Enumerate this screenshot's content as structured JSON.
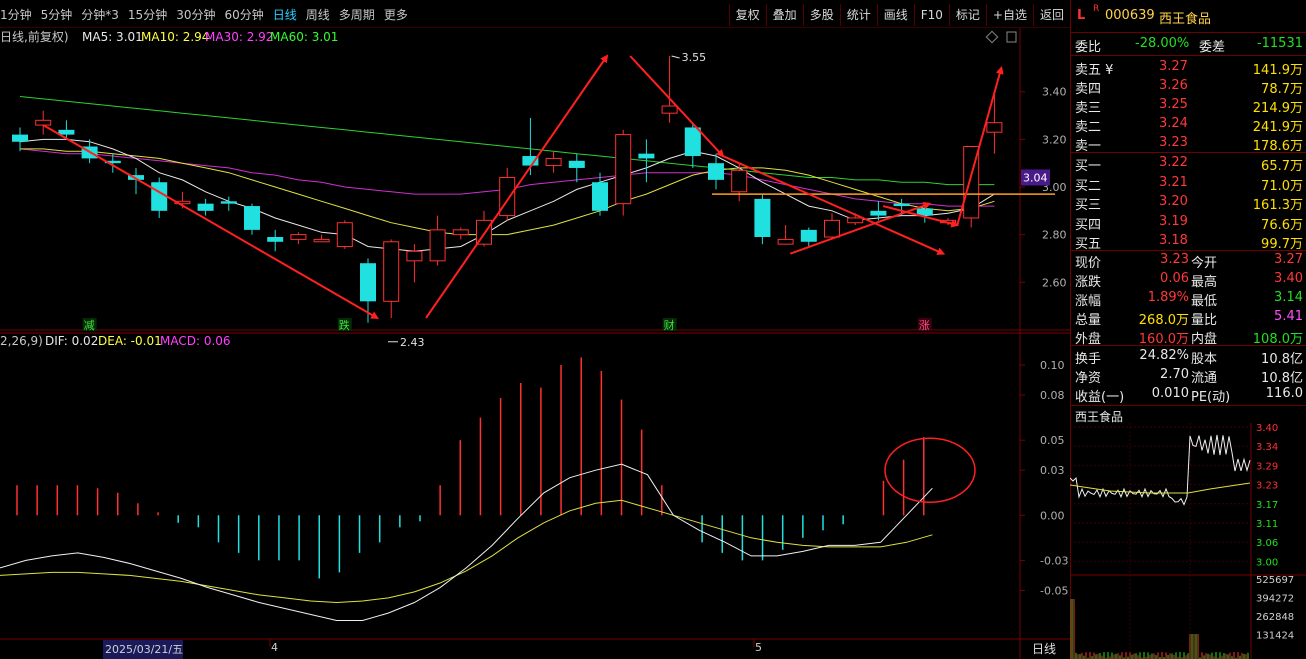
{
  "toolbar": {
    "periods": [
      "1分钟",
      "5分钟",
      "分钟*3",
      "15分钟",
      "30分钟",
      "60分钟",
      "日线",
      "周线",
      "多周期",
      "更多"
    ],
    "active_period": "日线",
    "buttons": [
      "复权",
      "叠加",
      "多股",
      "统计",
      "画线",
      "F10",
      "标记",
      "+自选",
      "返回"
    ]
  },
  "chart_header": {
    "prefix": "日线,前复权)",
    "ma5": "MA5: 3.01",
    "ma10": "MA10: 2.94",
    "ma30": "MA30: 2.92",
    "ma60": "MA60: 3.01"
  },
  "macd_header": {
    "prefix": "2,26,9)",
    "dif": "DIF: 0.02",
    "dea": "DEA: -0.01",
    "macd": "MACD: 0.06"
  },
  "price_axis": [
    "3.40",
    "3.20",
    "3.00",
    "2.80",
    "2.60"
  ],
  "current_price_tag": "3.04",
  "macd_axis": [
    "0.10",
    "0.08",
    "0.05",
    "0.03",
    "0.00",
    "-0.03",
    "-0.05"
  ],
  "annotations": {
    "high": "3.55",
    "low": "2.43"
  },
  "events": [
    "减",
    "跌",
    "财",
    "涨"
  ],
  "date_axis": {
    "date1": "2025/03/21/五",
    "month4": "4",
    "month5": "5",
    "period_label": "日线"
  },
  "chart_data": {
    "type": "candlestick",
    "price_range": [
      2.45,
      3.55
    ],
    "candles": [
      [
        3.22,
        3.19,
        3.25,
        3.15
      ],
      [
        3.26,
        3.28,
        3.32,
        3.22
      ],
      [
        3.24,
        3.22,
        3.28,
        3.2
      ],
      [
        3.17,
        3.12,
        3.2,
        3.1
      ],
      [
        3.11,
        3.1,
        3.14,
        3.06
      ],
      [
        3.05,
        3.03,
        3.08,
        2.97
      ],
      [
        3.02,
        2.9,
        3.04,
        2.87
      ],
      [
        2.93,
        2.94,
        2.98,
        2.91
      ],
      [
        2.93,
        2.9,
        2.95,
        2.88
      ],
      [
        2.94,
        2.93,
        2.96,
        2.9
      ],
      [
        2.92,
        2.82,
        2.93,
        2.8
      ],
      [
        2.79,
        2.77,
        2.82,
        2.73
      ],
      [
        2.78,
        2.8,
        2.81,
        2.76
      ],
      [
        2.77,
        2.78,
        2.8,
        2.77
      ],
      [
        2.75,
        2.85,
        2.86,
        2.74
      ],
      [
        2.68,
        2.52,
        2.7,
        2.43
      ],
      [
        2.52,
        2.77,
        2.78,
        2.45
      ],
      [
        2.69,
        2.73,
        2.76,
        2.6
      ],
      [
        2.69,
        2.82,
        2.88,
        2.67
      ],
      [
        2.8,
        2.82,
        2.83,
        2.78
      ],
      [
        2.76,
        2.86,
        2.9,
        2.75
      ],
      [
        2.88,
        3.04,
        3.08,
        2.86
      ],
      [
        3.13,
        3.09,
        3.29,
        3.05
      ],
      [
        3.09,
        3.12,
        3.15,
        3.06
      ],
      [
        3.11,
        3.08,
        3.14,
        3.02
      ],
      [
        3.02,
        2.9,
        3.06,
        2.88
      ],
      [
        2.93,
        3.22,
        3.24,
        2.88
      ],
      [
        3.14,
        3.12,
        3.2,
        3.02
      ],
      [
        3.31,
        3.34,
        3.55,
        3.27
      ],
      [
        3.25,
        3.13,
        3.27,
        3.08
      ],
      [
        3.1,
        3.03,
        3.14,
        2.99
      ],
      [
        2.98,
        3.07,
        3.1,
        2.94
      ],
      [
        2.95,
        2.79,
        2.97,
        2.76
      ],
      [
        2.76,
        2.78,
        2.84,
        2.76
      ],
      [
        2.82,
        2.77,
        2.83,
        2.75
      ],
      [
        2.79,
        2.86,
        2.89,
        2.78
      ],
      [
        2.85,
        2.87,
        2.89,
        2.84
      ],
      [
        2.9,
        2.88,
        2.94,
        2.86
      ],
      [
        2.93,
        2.92,
        2.95,
        2.88
      ],
      [
        2.91,
        2.88,
        2.93,
        2.85
      ],
      [
        2.85,
        2.86,
        2.87,
        2.84
      ],
      [
        2.87,
        3.17,
        3.17,
        2.83
      ],
      [
        3.23,
        3.27,
        3.4,
        3.14
      ]
    ],
    "ma5": [
      3.19,
      3.2,
      3.2,
      3.19,
      3.16,
      3.12,
      3.06,
      3.03,
      2.98,
      2.94,
      2.91,
      2.87,
      2.84,
      2.81,
      2.8,
      2.75,
      2.74,
      2.73,
      2.74,
      2.75,
      2.8,
      2.86,
      2.9,
      2.94,
      2.99,
      3.02,
      3.05,
      3.08,
      3.12,
      3.15,
      3.13,
      3.08,
      3.02,
      2.97,
      2.92,
      2.9,
      2.86,
      2.87,
      2.88,
      2.88,
      2.89,
      2.91,
      2.97
    ],
    "ma10": [
      3.16,
      3.16,
      3.15,
      3.15,
      3.14,
      3.13,
      3.12,
      3.1,
      3.08,
      3.06,
      3.03,
      3.0,
      2.97,
      2.94,
      2.91,
      2.88,
      2.85,
      2.83,
      2.81,
      2.8,
      2.8,
      2.8,
      2.82,
      2.84,
      2.87,
      2.9,
      2.94,
      2.97,
      3.01,
      3.05,
      3.07,
      3.08,
      3.08,
      3.07,
      3.05,
      3.02,
      2.99,
      2.96,
      2.93,
      2.91,
      2.9,
      2.91,
      2.94
    ],
    "ma30": [
      3.16,
      3.15,
      3.14,
      3.14,
      3.13,
      3.12,
      3.11,
      3.1,
      3.09,
      3.08,
      3.06,
      3.05,
      3.03,
      3.02,
      3.0,
      2.99,
      2.98,
      2.97,
      2.97,
      2.97,
      2.98,
      2.99,
      3.01,
      3.02,
      3.03,
      3.04,
      3.05,
      3.06,
      3.06,
      3.06,
      3.06,
      3.05,
      3.03,
      3.01,
      2.99,
      2.97,
      2.95,
      2.94,
      2.93,
      2.93,
      2.92,
      2.92,
      2.92
    ],
    "ma60": [
      3.38,
      3.37,
      3.36,
      3.35,
      3.34,
      3.33,
      3.32,
      3.31,
      3.3,
      3.29,
      3.28,
      3.27,
      3.26,
      3.25,
      3.24,
      3.23,
      3.22,
      3.21,
      3.2,
      3.19,
      3.18,
      3.17,
      3.16,
      3.15,
      3.14,
      3.13,
      3.12,
      3.11,
      3.1,
      3.09,
      3.08,
      3.07,
      3.06,
      3.05,
      3.04,
      3.04,
      3.03,
      3.03,
      3.02,
      3.02,
      3.01,
      3.01,
      3.01
    ],
    "macd_range": [
      -0.075,
      0.11
    ],
    "macd_hist": [
      0.02,
      0.02,
      0.02,
      0.02,
      0.018,
      0.015,
      0.008,
      0.002,
      -0.005,
      -0.008,
      -0.018,
      -0.025,
      -0.03,
      -0.03,
      -0.03,
      -0.042,
      -0.038,
      -0.025,
      -0.018,
      -0.008,
      -0.004,
      0.02,
      0.05,
      0.065,
      0.078,
      0.088,
      0.085,
      0.1,
      0.105,
      0.096,
      0.077,
      0.057,
      0.02,
      0.0,
      -0.018,
      -0.025,
      -0.03,
      -0.03,
      -0.023,
      -0.015,
      -0.01,
      -0.006,
      0.0,
      0.023,
      0.037,
      0.052
    ],
    "dif": [
      -0.035,
      -0.03,
      -0.027,
      -0.025,
      -0.028,
      -0.032,
      -0.037,
      -0.042,
      -0.048,
      -0.053,
      -0.058,
      -0.062,
      -0.066,
      -0.07,
      -0.07,
      -0.065,
      -0.058,
      -0.048,
      -0.035,
      -0.02,
      -0.002,
      0.015,
      0.025,
      0.03,
      0.034,
      0.027,
      0.0,
      -0.01,
      -0.018,
      -0.027,
      -0.027,
      -0.024,
      -0.02,
      -0.02,
      -0.018,
      0.0,
      0.018
    ],
    "dea": [
      -0.04,
      -0.039,
      -0.038,
      -0.038,
      -0.039,
      -0.04,
      -0.042,
      -0.044,
      -0.047,
      -0.05,
      -0.053,
      -0.055,
      -0.057,
      -0.058,
      -0.057,
      -0.055,
      -0.051,
      -0.045,
      -0.037,
      -0.027,
      -0.015,
      -0.005,
      0.003,
      0.008,
      0.01,
      0.005,
      0.0,
      -0.005,
      -0.01,
      -0.015,
      -0.018,
      -0.02,
      -0.021,
      -0.021,
      -0.021,
      -0.018,
      -0.013
    ]
  },
  "quote": {
    "code": "000639",
    "name": "西王食品",
    "flag_l": "L",
    "flag_r": "R",
    "weibi_label": "委比",
    "weibi_value": "-28.00%",
    "weicha_label": "委差",
    "weicha_value": "-11531",
    "asks": [
      {
        "label": "卖五",
        "mark": "¥",
        "price": "3.27",
        "vol": "141.9万"
      },
      {
        "label": "卖四",
        "mark": "",
        "price": "3.26",
        "vol": "78.7万"
      },
      {
        "label": "卖三",
        "mark": "",
        "price": "3.25",
        "vol": "214.9万"
      },
      {
        "label": "卖二",
        "mark": "",
        "price": "3.24",
        "vol": "241.9万"
      },
      {
        "label": "卖一",
        "mark": "",
        "price": "3.23",
        "vol": "178.6万"
      }
    ],
    "bids": [
      {
        "label": "买一",
        "price": "3.22",
        "vol": "65.7万"
      },
      {
        "label": "买二",
        "price": "3.21",
        "vol": "71.0万"
      },
      {
        "label": "买三",
        "price": "3.20",
        "vol": "161.3万"
      },
      {
        "label": "买四",
        "price": "3.19",
        "vol": "76.6万"
      },
      {
        "label": "买五",
        "price": "3.18",
        "vol": "99.7万"
      }
    ],
    "stats": [
      {
        "l1": "现价",
        "v1": "3.23",
        "c1": "red",
        "l2": "今开",
        "v2": "3.27",
        "c2": "red"
      },
      {
        "l1": "涨跌",
        "v1": "0.06",
        "c1": "red",
        "l2": "最高",
        "v2": "3.40",
        "c2": "red"
      },
      {
        "l1": "涨幅",
        "v1": "1.89%",
        "c1": "red",
        "l2": "最低",
        "v2": "3.14",
        "c2": "green"
      },
      {
        "l1": "总量",
        "v1": "268.0万",
        "c1": "yellow",
        "l2": "量比",
        "v2": "5.41",
        "c2": "magenta"
      },
      {
        "l1": "外盘",
        "v1": "160.0万",
        "c1": "red",
        "l2": "内盘",
        "v2": "108.0万",
        "c2": "green"
      }
    ],
    "extra": [
      {
        "l1": "换手",
        "v1": "24.82%",
        "l2": "股本",
        "v2": "10.8亿"
      },
      {
        "l1": "净资",
        "v1": "2.70",
        "l2": "流通",
        "v2": "10.8亿"
      },
      {
        "l1": "收益(一)",
        "v1": "0.010",
        "l2": "PE(动)",
        "v2": "116.0"
      }
    ]
  },
  "mini_chart": {
    "title": "西王食品",
    "price_labels": [
      "3.40",
      "3.34",
      "3.29",
      "3.23",
      "3.17",
      "3.11",
      "3.06",
      "3.00"
    ],
    "vol_labels": [
      "525697",
      "394272",
      "262848",
      "131424"
    ]
  }
}
